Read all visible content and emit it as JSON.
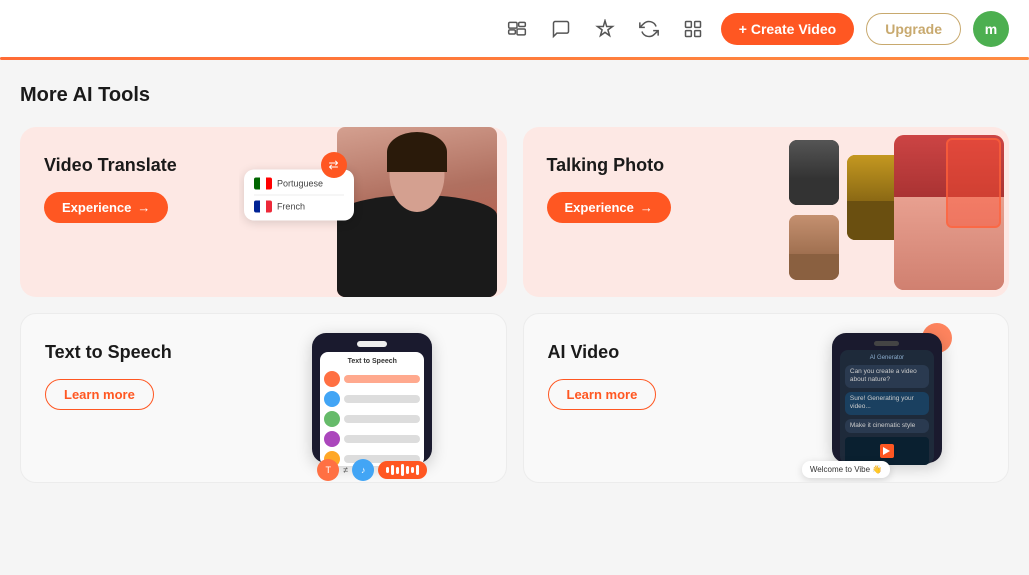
{
  "header": {
    "create_video_label": "+ Create Video",
    "upgrade_label": "Upgrade",
    "avatar_initial": "m"
  },
  "main": {
    "section_title": "More AI Tools",
    "cards": [
      {
        "id": "video-translate",
        "title": "Video Translate",
        "cta_label": "Experience",
        "cta_type": "experience",
        "bg": "pink"
      },
      {
        "id": "talking-photo",
        "title": "Talking Photo",
        "cta_label": "Experience",
        "cta_type": "experience",
        "bg": "pink"
      },
      {
        "id": "text-to-speech",
        "title": "Text to Speech",
        "cta_label": "Learn more",
        "cta_type": "learn-more",
        "bg": "light"
      },
      {
        "id": "ai-video",
        "title": "AI Video",
        "cta_label": "Learn more",
        "cta_type": "learn-more",
        "bg": "light"
      }
    ]
  }
}
